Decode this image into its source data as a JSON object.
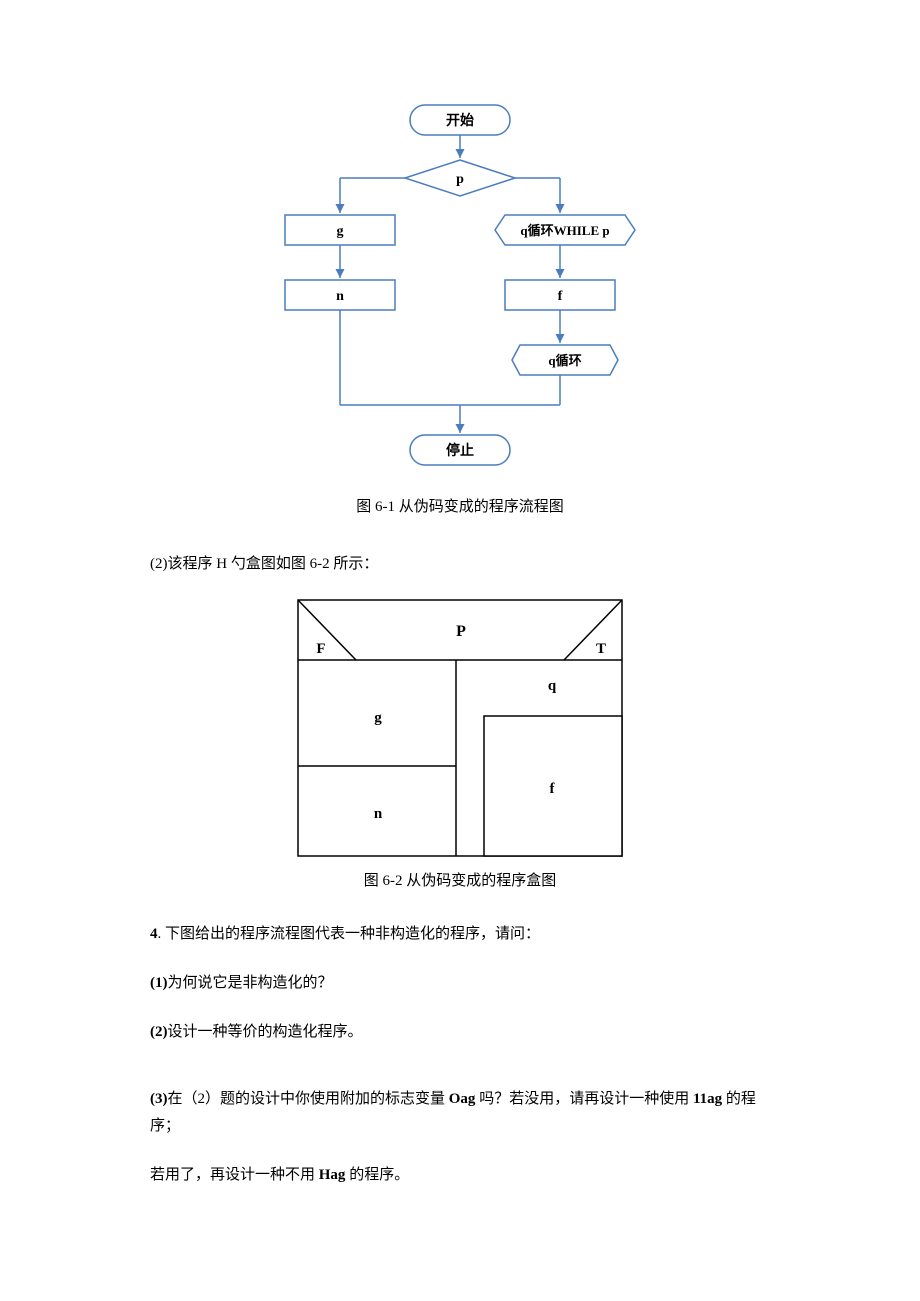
{
  "flow": {
    "start": "开始",
    "stop": "停止",
    "decision": "p",
    "box_g": "g",
    "box_n": "n",
    "loop_head": "q循环WHILE p",
    "box_f": "f",
    "loop_tail": "q循环",
    "caption": "图 6-1 从伪码变成的程序流程图"
  },
  "text1": "(2)该程序 H 勺盒图如图 6-2 所示：",
  "ns": {
    "P": "P",
    "F": "F",
    "T": "T",
    "g": "g",
    "n": "n",
    "q": "q",
    "f": "f",
    "caption": "图 6-2 从伪码变成的程序盒图"
  },
  "q": {
    "prefix": "4",
    "body": ". 下图给出的程序流程图代表一种非构造化的程序，请问：",
    "s1_prefix": "(1)",
    "s1": "为何说它是非构造化的？",
    "s2_prefix": "(2)",
    "s2": "设计一种等价的构造化程序。",
    "s3_prefix": "(3)",
    "s3_a": "在（2）题的设计中你使用附加的标志变量 ",
    "s3_oag": "Oag",
    "s3_b": " 吗？若没用，请再设计一种使用 ",
    "s3_11ag": "11ag",
    "s3_c": " 的程序；",
    "s4_a": "若用了，再设计一种不用 ",
    "s4_hag": "Hag",
    "s4_b": " 的程序。"
  }
}
